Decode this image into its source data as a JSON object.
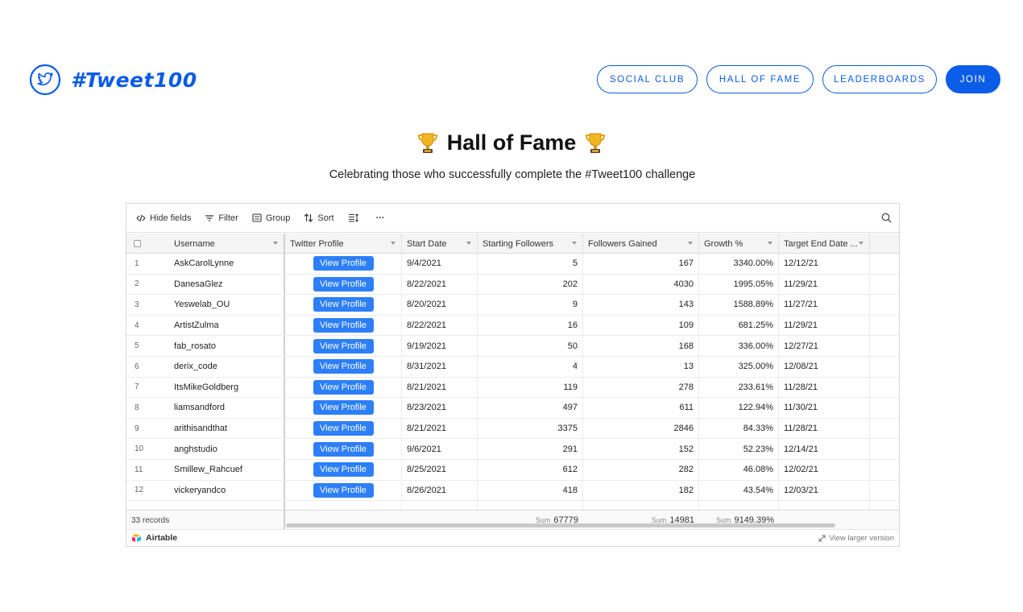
{
  "header": {
    "logo_text": "#Tweet100",
    "nav": [
      {
        "label": "SOCIAL CLUB"
      },
      {
        "label": "HALL OF FAME"
      },
      {
        "label": "LEADERBOARDS"
      },
      {
        "label": "JOIN"
      }
    ]
  },
  "hero": {
    "title": "Hall of Fame",
    "subtitle": "Celebrating those who successfully complete the #Tweet100 challenge"
  },
  "toolbar": {
    "hide_fields": "Hide fields",
    "filter": "Filter",
    "group": "Group",
    "sort": "Sort",
    "more": "···"
  },
  "table": {
    "columns": [
      "Username",
      "Twitter Profile",
      "Start Date",
      "Starting Followers",
      "Followers Gained",
      "Growth %",
      "Target End Date ..."
    ],
    "button_label": "View Profile",
    "rows": [
      {
        "n": "1",
        "user": "AskCarolLynne",
        "start": "9/4/2021",
        "sf": "5",
        "fg": "167",
        "gr": "3340.00%",
        "te": "12/12/21"
      },
      {
        "n": "2",
        "user": "DanesaGlez",
        "start": "8/22/2021",
        "sf": "202",
        "fg": "4030",
        "gr": "1995.05%",
        "te": "11/29/21"
      },
      {
        "n": "3",
        "user": "Yeswelab_OU",
        "start": "8/20/2021",
        "sf": "9",
        "fg": "143",
        "gr": "1588.89%",
        "te": "11/27/21"
      },
      {
        "n": "4",
        "user": "ArtistZulma",
        "start": "8/22/2021",
        "sf": "16",
        "fg": "109",
        "gr": "681.25%",
        "te": "11/29/21"
      },
      {
        "n": "5",
        "user": "fab_rosato",
        "start": "9/19/2021",
        "sf": "50",
        "fg": "168",
        "gr": "336.00%",
        "te": "12/27/21"
      },
      {
        "n": "6",
        "user": "derix_code",
        "start": "8/31/2021",
        "sf": "4",
        "fg": "13",
        "gr": "325.00%",
        "te": "12/08/21"
      },
      {
        "n": "7",
        "user": "ItsMikeGoldberg",
        "start": "8/21/2021",
        "sf": "119",
        "fg": "278",
        "gr": "233.61%",
        "te": "11/28/21"
      },
      {
        "n": "8",
        "user": "liamsandford",
        "start": "8/23/2021",
        "sf": "497",
        "fg": "611",
        "gr": "122.94%",
        "te": "11/30/21"
      },
      {
        "n": "9",
        "user": "arithisandthat",
        "start": "8/21/2021",
        "sf": "3375",
        "fg": "2846",
        "gr": "84.33%",
        "te": "11/28/21"
      },
      {
        "n": "10",
        "user": "anghstudio",
        "start": "9/6/2021",
        "sf": "291",
        "fg": "152",
        "gr": "52.23%",
        "te": "12/14/21"
      },
      {
        "n": "11",
        "user": "Smillew_Rahcuef",
        "start": "8/25/2021",
        "sf": "612",
        "fg": "282",
        "gr": "46.08%",
        "te": "12/02/21"
      },
      {
        "n": "12",
        "user": "vickeryandco",
        "start": "8/26/2021",
        "sf": "418",
        "fg": "182",
        "gr": "43.54%",
        "te": "12/03/21"
      },
      {
        "n": "",
        "user": "",
        "start": "",
        "sf": "",
        "fg": "",
        "gr": "",
        "te": ""
      }
    ]
  },
  "summary": {
    "records": "33 records",
    "sum_label": "Sum",
    "sum_sf": "67779",
    "sum_fg": "14981",
    "sum_gr": "9149.39%"
  },
  "footer": {
    "brand": "Airtable",
    "larger": "View larger version"
  },
  "colors": {
    "brand_blue": "#0b5ce6",
    "button_blue": "#2d7ff9"
  }
}
